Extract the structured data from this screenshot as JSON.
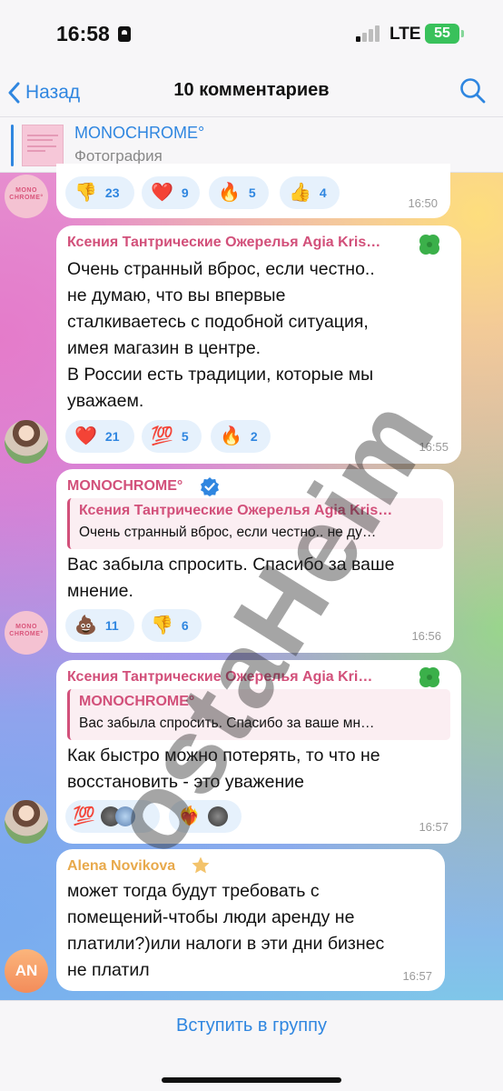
{
  "status_bar": {
    "time": "16:58",
    "network": "LTE",
    "battery": "55"
  },
  "nav": {
    "back_label": "Назад",
    "title": "10 комментариев"
  },
  "pinned": {
    "title": "MONOCHROME°",
    "subtitle": "Фотография"
  },
  "avatars": {
    "mono_logo_text": "MONO CHROME°",
    "an_initials": "AN"
  },
  "messages": [
    {
      "time": "16:50",
      "reactions": [
        {
          "emoji": "👎",
          "count": "23"
        },
        {
          "emoji": "❤️",
          "count": "9"
        },
        {
          "emoji": "🔥",
          "count": "5"
        },
        {
          "emoji": "👍",
          "count": "4"
        }
      ]
    },
    {
      "sender": "Ксения Тантрические Ожерелья Agia Kris…",
      "text_lines": [
        "Очень странный вброс, если честно..",
        "не думаю, что вы впервые",
        "сталкиваетесь с подобной ситуация,",
        "имея магазин в центре.",
        "В России есть традиции, которые мы",
        "уважаем."
      ],
      "time": "16:55",
      "reactions": [
        {
          "emoji": "❤️",
          "count": "21"
        },
        {
          "emoji": "💯",
          "count": "5"
        },
        {
          "emoji": "🔥",
          "count": "2"
        }
      ]
    },
    {
      "sender": "MONOCHROME°",
      "reply_name": "Ксения Тантрические Ожерелья Agia Kris…",
      "reply_text": "Очень странный вброс, если честно.. не ду…",
      "text_lines": [
        "Вас забыла спросить. Спасибо за ваше",
        "мнение."
      ],
      "time": "16:56",
      "reactions": [
        {
          "emoji": "💩",
          "count": "11"
        },
        {
          "emoji": "👎",
          "count": "6"
        }
      ]
    },
    {
      "sender": "Ксения Тантрические Ожерелья Agia Kri…",
      "reply_name": "MONOCHROME°",
      "reply_text": "Вас забыла спросить. Спасибо за ваше мн…",
      "text_lines": [
        "Как быстро можно потерять, то что не",
        "восстановить - это уважение"
      ],
      "time": "16:57",
      "reactions": [
        {
          "emoji": "💯"
        },
        {
          "emoji": "❤️‍🔥"
        }
      ]
    },
    {
      "sender": "Alena Novikova",
      "text_lines": [
        "может тогда будут требовать с",
        "помещений-чтобы люди аренду не",
        "платили?)или налоги в эти дни бизнес",
        "не платил"
      ],
      "time": "16:57"
    }
  ],
  "join_button": "Вступить в группу",
  "watermark": "ostaHeim",
  "colors": {
    "accent": "#2f86e0",
    "sender_pink": "#d2507a",
    "verified": "#2f86e0",
    "star": "#f3c36b",
    "alena_name": "#e8a94b"
  }
}
